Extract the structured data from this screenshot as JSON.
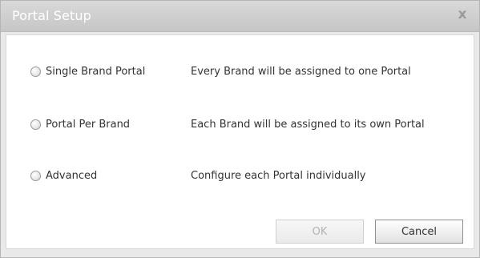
{
  "window": {
    "title": "Portal Setup",
    "close_glyph": "x"
  },
  "options": [
    {
      "label": "Single Brand Portal",
      "description": "Every Brand will be assigned to one Portal",
      "selected": false
    },
    {
      "label": "Portal Per Brand",
      "description": "Each Brand will be assigned to its own Portal",
      "selected": false
    },
    {
      "label": "Advanced",
      "description": "Configure each Portal individually",
      "selected": false
    }
  ],
  "buttons": {
    "ok_label": "OK",
    "ok_enabled": false,
    "cancel_label": "Cancel"
  },
  "colors": {
    "titlebar": "#cfcfcf",
    "text": "#333333",
    "disabled_text": "#b3b3b3",
    "panel": "#ffffff"
  }
}
